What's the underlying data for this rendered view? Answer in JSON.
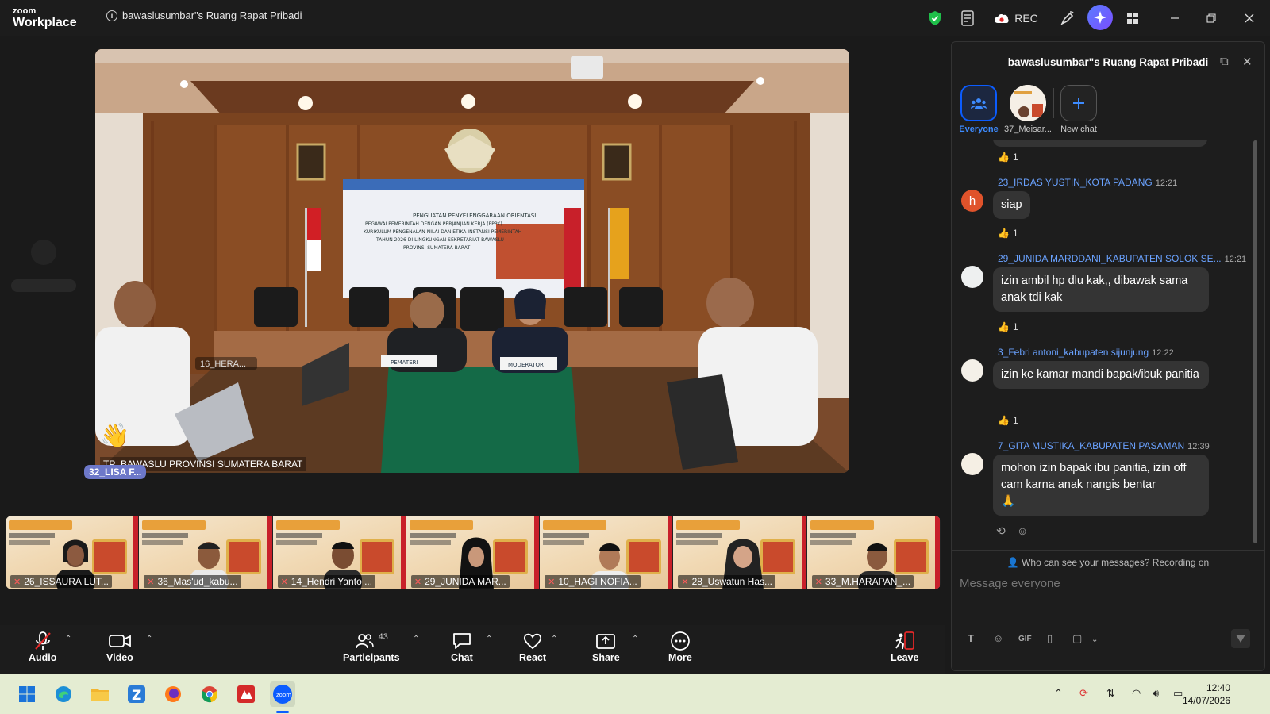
{
  "app": {
    "brand_top": "zoom",
    "brand_bottom": "Workplace",
    "meeting_title": "bawaslusumbar\"s Ruang Rapat Pribadi",
    "rec_label": "REC"
  },
  "main_video": {
    "name_label": "TP_BAWASLU PROVINSI SUMATERA BARAT",
    "overlay_tag": "32_LISA F...",
    "overlay_name": "16_HERA...",
    "banner_lines": [
      "PENGUATAN PENYELENGGARAAN ORIENTASI",
      "PEGAWAI PEMERINTAH DENGAN PERJANJIAN KERJA (PPPK)",
      "KURIKULUM PENGENALAN NILAI DAN ETIKA INSTANSI PEMERINTAH",
      "TAHUN 2026 DI LINGKUNGAN SEKRETARIAT BAWASLU",
      "PROVINSI SUMATERA BARAT"
    ],
    "placard_left": "PEMATERI",
    "placard_right": "MODERATOR"
  },
  "filmstrip": [
    {
      "name": "26_ISSAURA LUT..."
    },
    {
      "name": "36_Mas'ud_kabu..."
    },
    {
      "name": "14_Hendri Yanto ..."
    },
    {
      "name": "29_JUNIDA MAR..."
    },
    {
      "name": "10_HAGI NOFIA..."
    },
    {
      "name": "28_Uswatun Has..."
    },
    {
      "name": "33_M.HARAPAN_..."
    }
  ],
  "toolbar": {
    "audio": "Audio",
    "video": "Video",
    "participants": "Participants",
    "participants_count": "43",
    "chat": "Chat",
    "react": "React",
    "share": "Share",
    "more": "More",
    "leave": "Leave"
  },
  "chat": {
    "title": "bawaslusumbar\"s Ruang Rapat Pribadi",
    "tabs": [
      {
        "label": "Everyone"
      },
      {
        "label": "37_Meisar..."
      },
      {
        "label": "New chat"
      }
    ],
    "messages": [
      {
        "sender": "23_IRDAS YUSTIN_KOTA PADANG",
        "time": "12:21",
        "text": "siap",
        "avatar_letter": "h",
        "reaction_count": "1"
      },
      {
        "sender": "29_JUNIDA MARDDANI_KABUPATEN SOLOK SE...",
        "time": "12:21",
        "text": "izin ambil hp dlu kak,, dibawak sama anak tdi kak",
        "reaction_count": "1"
      },
      {
        "sender": "3_Febri antoni_kabupaten sijunjung",
        "time": "12:22",
        "text": "izin ke kamar mandi bapak/ibuk panitia",
        "reaction_count": "1"
      },
      {
        "sender": "7_GITA MUSTIKA_KABUPATEN PASAMAN",
        "time": "12:39",
        "text": "mohon izin bapak ibu panitia, izin off cam karna anak nangis bentar",
        "emoji": "🙏"
      }
    ],
    "top_reaction_count": "1",
    "privacy_note": "Who can see your messages? Recording on",
    "input_placeholder": "Message everyone",
    "format_gif": "GIF"
  },
  "taskbar": {
    "time": "12:40",
    "date": "14/07/2026"
  },
  "colors": {
    "accent": "#0b5cff",
    "leave": "#e02828",
    "link": "#6aa2ff"
  }
}
